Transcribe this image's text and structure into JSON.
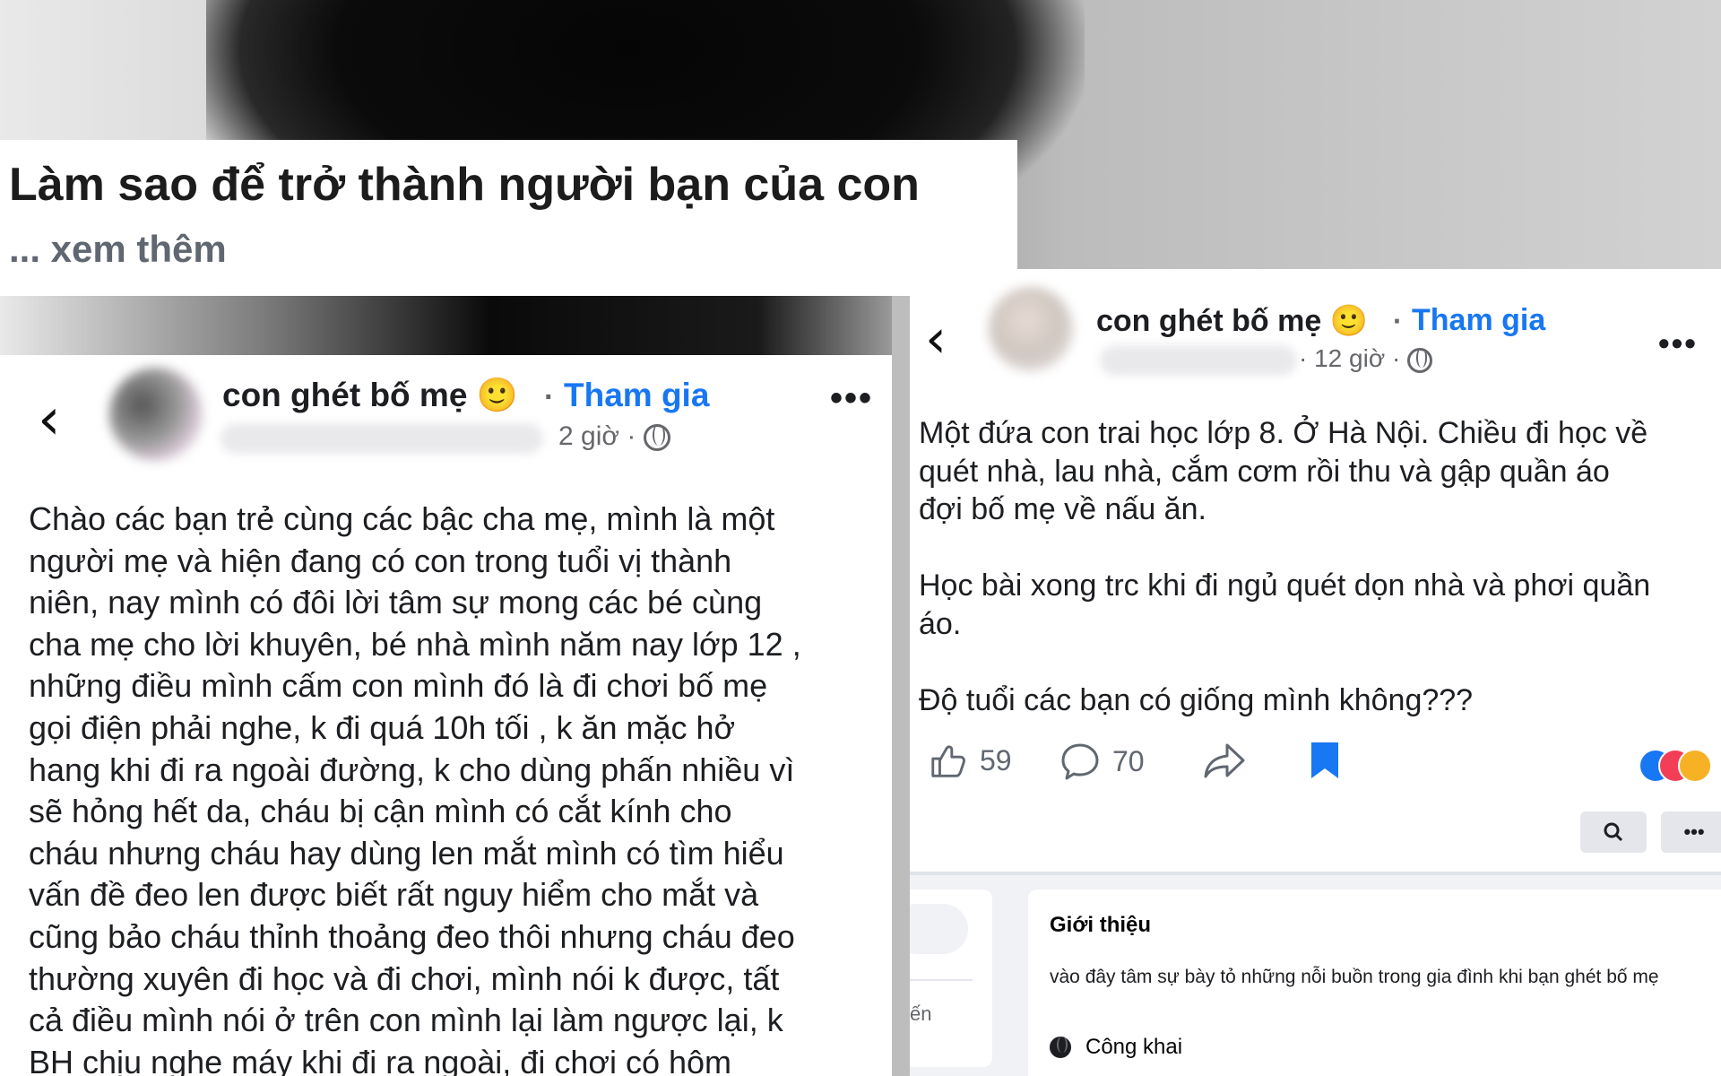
{
  "title_card": {
    "title": "Làm sao để trở thành người bạn của con",
    "see_more": "... xem thêm"
  },
  "left_post": {
    "group_name": "con ghét bố mẹ 🙂",
    "separator": "·",
    "join": "Tham gia",
    "time": "2 giờ ·",
    "body": "Chào các bạn trẻ cùng các bậc cha mẹ, mình là một\nngười mẹ và hiện đang có con trong tuổi vị thành\nniên, nay mình có đôi lời tâm sự mong các bé cùng\ncha mẹ cho lời khuyên, bé nhà mình năm nay lớp 12 ,\nnhững điều mình cấm con mình đó là đi chơi bố mẹ\ngọi điện phải nghe, k đi quá 10h tối , k ăn mặc hở\nhang khi đi ra ngoài đường, k cho dùng phấn nhiều vì\nsẽ hỏng hết da, cháu bị cận mình có cắt kính cho\ncháu nhưng cháu hay dùng len mắt mình có tìm hiểu\nvấn đề đeo len được biết rất nguy hiểm cho mắt và\ncũng bảo cháu thỉnh thoảng đeo thôi nhưng cháu đeo\nthường xuyên đi học và đi chơi, mình nói k được, tất\ncả điều mình nói ở trên con mình lại làm ngược lại, k\nBH chịu nghe máy khi đi ra ngoài, đi chơi có hôm"
  },
  "right_post": {
    "group_name": "con ghét bố mẹ 🙂",
    "separator": "·",
    "join": "Tham gia",
    "time": "· 12 giờ ·",
    "body": "Một đứa con trai học lớp 8. Ở Hà Nội. Chiều đi học về\nquét nhà, lau nhà, cắm cơm rồi thu và gập quần áo\nđợi bố mẹ về nấu ăn.\n\nHọc bài xong trc khi đi ngủ quét dọn nhà và phơi quần\náo.\n\nĐộ tuổi các bạn có giống mình không???",
    "likes": "59",
    "comments": "70"
  },
  "group_about": {
    "side_text": "ến",
    "title": "Giới thiệu",
    "description": "vào đây tâm sự bày tỏ những nỗi buồn trong gia đình khi bạn ghét bố mẹ",
    "privacy": "Công khai"
  },
  "icons": [
    "back-icon",
    "globe-icon",
    "more-icon",
    "like-icon",
    "comment-icon",
    "share-icon",
    "bookmark-icon",
    "search-icon"
  ],
  "colors": {
    "link_blue": "#1877f2",
    "secondary_text": "#65676b",
    "text": "#1c1e21"
  }
}
